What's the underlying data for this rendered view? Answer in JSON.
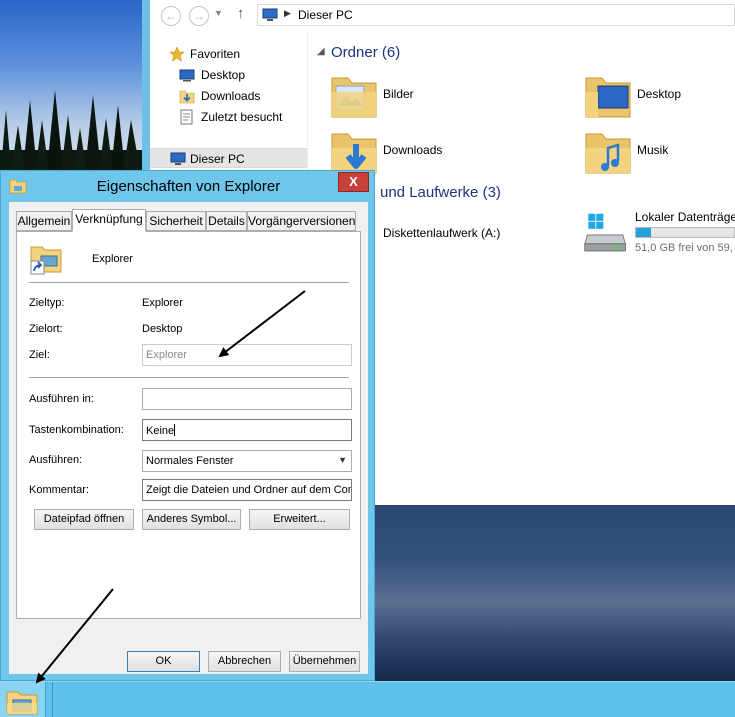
{
  "explorer": {
    "address": "Dieser PC",
    "nav": {
      "favorites": "Favoriten",
      "desktop": "Desktop",
      "downloads": "Downloads",
      "recent": "Zuletzt besucht",
      "this_pc": "Dieser PC"
    },
    "folders_header": "Ordner (6)",
    "folders": [
      "Bilder",
      "Desktop",
      "Downloads",
      "Musik"
    ],
    "drives_header": "und Laufwerke (3)",
    "drives": {
      "floppy": "Diskettenlaufwerk (A:)",
      "local": "Lokaler Datenträge",
      "local_free": "51,0 GB frei von 59,",
      "local_used_fraction": 0.15
    }
  },
  "dialog": {
    "title": "Eigenschaften von Explorer",
    "close": "X",
    "tabs": [
      "Allgemein",
      "Verknüpfung",
      "Sicherheit",
      "Details",
      "Vorgängerversionen"
    ],
    "active_tab": "Verknüpfung",
    "shortcut_name": "Explorer",
    "fields": {
      "target_type_label": "Zieltyp:",
      "target_type": "Explorer",
      "target_location_label": "Zielort:",
      "target_location": "Desktop",
      "target_label": "Ziel:",
      "target": "Explorer",
      "start_in_label": "Ausführen in:",
      "start_in": "",
      "hotkey_label": "Tastenkombination:",
      "hotkey": "Keine",
      "run_label": "Ausführen:",
      "run": "Normales Fenster",
      "comment_label": "Kommentar:",
      "comment": "Zeigt die Dateien und Ordner auf dem Comp"
    },
    "buttons": {
      "open_location": "Dateipfad öffnen",
      "change_icon": "Anderes Symbol...",
      "advanced": "Erweitert...",
      "ok": "OK",
      "cancel": "Abbrechen",
      "apply": "Übernehmen"
    }
  },
  "colors": {
    "dialog_frame": "#6ec6ea",
    "taskbar": "#5fc2ec",
    "group_header": "#1e3287",
    "close_button": "#c7403a"
  },
  "icons": [
    "back-icon",
    "forward-icon",
    "up-icon",
    "computer-icon",
    "star-icon",
    "folder-icon",
    "floppy-icon",
    "hard-drive-icon",
    "shortcut-folder-icon",
    "close-icon",
    "dropdown-arrow-icon"
  ]
}
